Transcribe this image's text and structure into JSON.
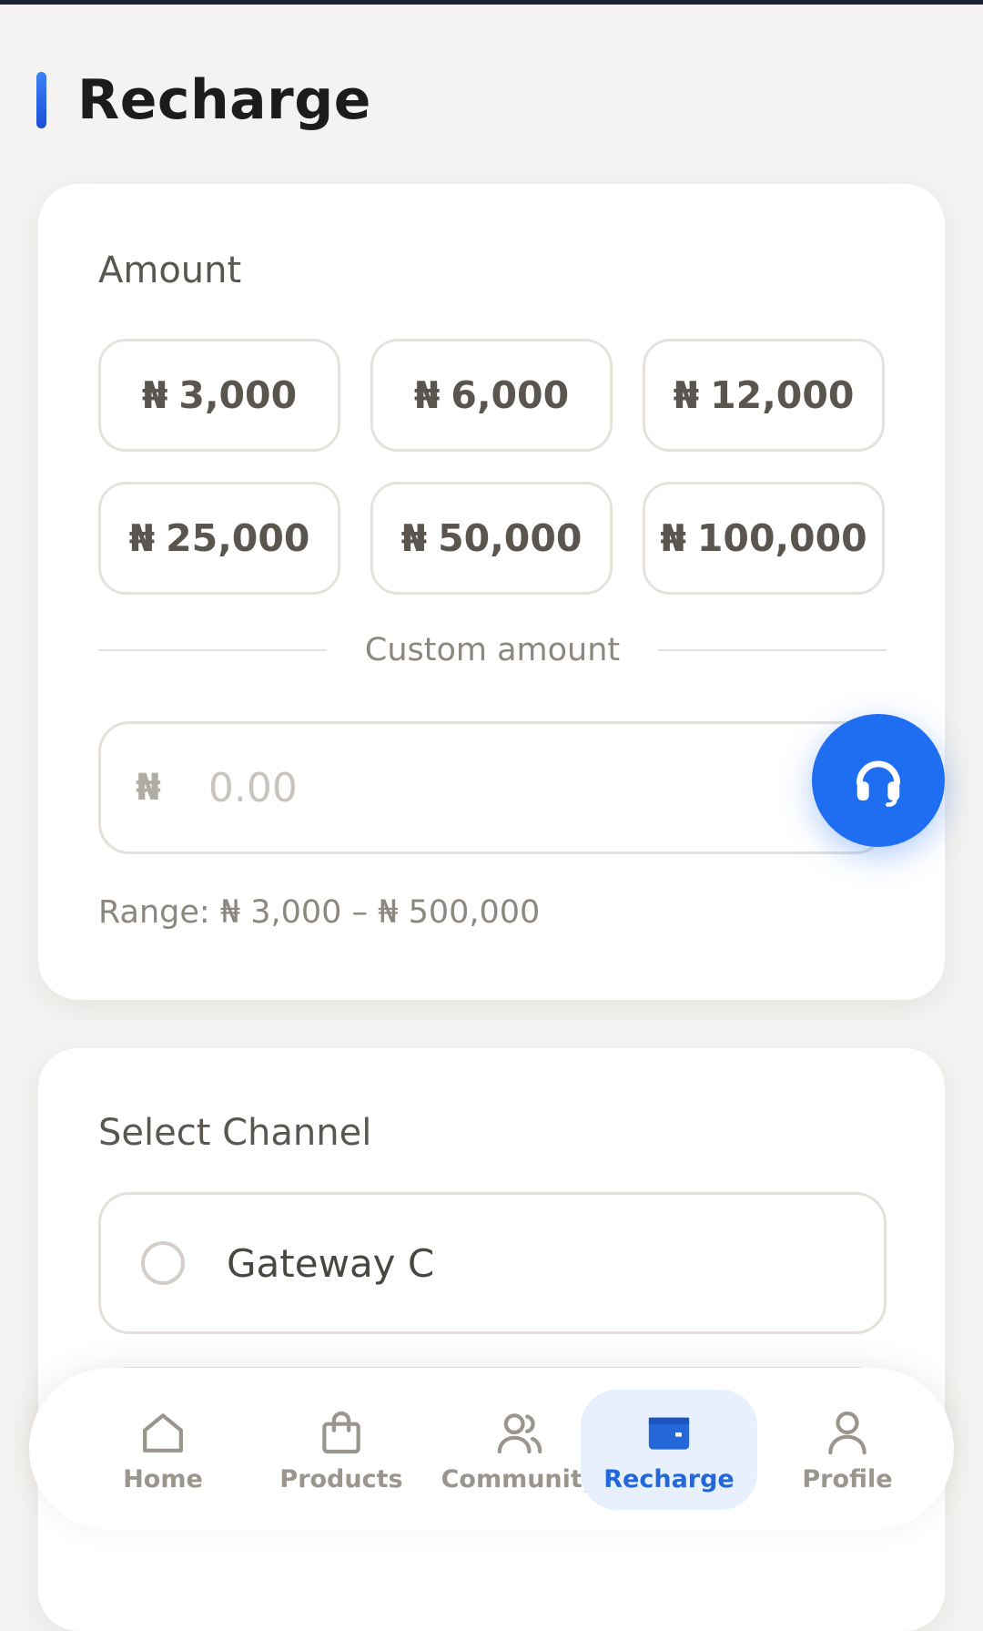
{
  "header": {
    "title": "Recharge"
  },
  "amount_section": {
    "label": "Amount",
    "currency_symbol": "₦",
    "options": [
      {
        "value": "3,000"
      },
      {
        "value": "6,000"
      },
      {
        "value": "12,000"
      },
      {
        "value": "25,000"
      },
      {
        "value": "50,000"
      },
      {
        "value": "100,000"
      }
    ],
    "custom_amount_label": "Custom amount",
    "custom_input": {
      "currency": "₦",
      "placeholder": "0.00",
      "value": ""
    },
    "range_text": "Range: ₦ 3,000 – ₦ 500,000"
  },
  "support_button": {
    "icon": "headset-icon"
  },
  "channel_section": {
    "label": "Select Channel",
    "options": [
      {
        "label": "Gateway C",
        "selected": false
      },
      {
        "label": "",
        "selected": false
      }
    ]
  },
  "bottom_nav": {
    "items": [
      {
        "label": "Home",
        "icon": "home-icon",
        "active": false
      },
      {
        "label": "Products",
        "icon": "shopping-bag-icon",
        "active": false
      },
      {
        "label": "Community",
        "icon": "users-icon",
        "active": false
      },
      {
        "label": "Recharge",
        "icon": "wallet-icon",
        "active": true
      },
      {
        "label": "Profile",
        "icon": "user-icon",
        "active": false
      }
    ]
  },
  "colors": {
    "accent": "#1f6df0",
    "nav_active_bg": "#e8f0fd",
    "nav_active_text": "#2467d8",
    "background": "#f4f3f1"
  }
}
